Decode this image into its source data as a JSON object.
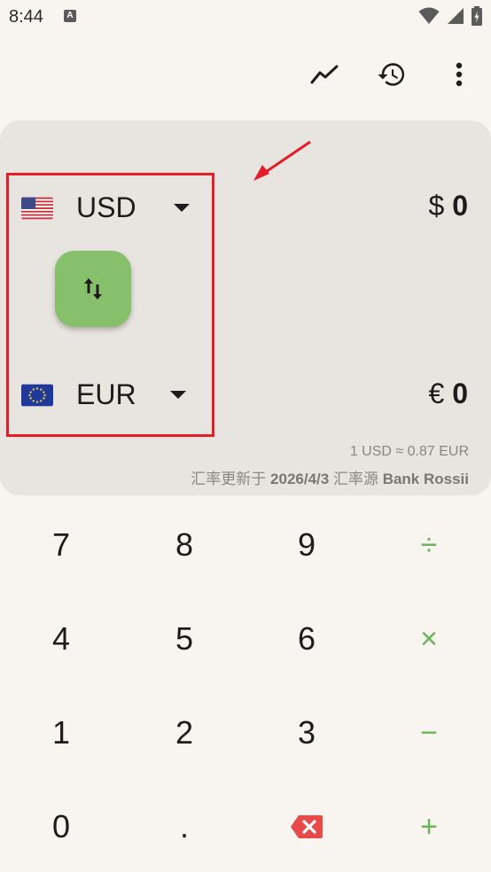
{
  "status": {
    "time": "8:44",
    "notif_badge": "A"
  },
  "toolbar": {
    "chart_icon": "chart-line-icon",
    "history_icon": "history-icon",
    "menu_icon": "more-vert-icon"
  },
  "converter": {
    "from": {
      "code": "USD",
      "symbol": "$",
      "amount": "0",
      "flag": "us-flag-icon"
    },
    "to": {
      "code": "EUR",
      "symbol": "€",
      "amount": "0",
      "flag": "eu-flag-icon"
    },
    "rate": "1 USD ≈ 0.87 EUR",
    "updated_prefix": "汇率更新于",
    "updated_date": "2026/4/3",
    "source_prefix": "汇率源",
    "source_name": "Bank Rossii"
  },
  "keypad": {
    "row1": [
      "7",
      "8",
      "9",
      "÷"
    ],
    "row2": [
      "4",
      "5",
      "6",
      "×"
    ],
    "row3": [
      "1",
      "2",
      "3",
      "−"
    ],
    "row4": [
      "0",
      ".",
      "backspace",
      "+"
    ]
  },
  "colors": {
    "accent": "#87c06b",
    "operator": "#6db35a",
    "highlight": "#e51d2a",
    "card": "#e8e4e0",
    "backspace": "#e84a4a"
  }
}
